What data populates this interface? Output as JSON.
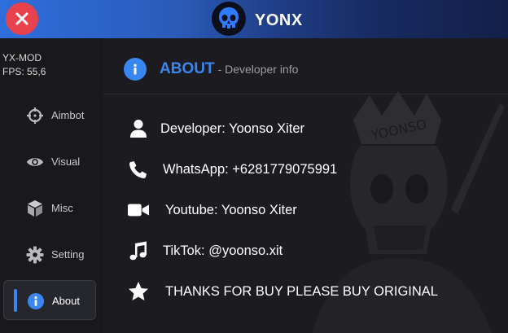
{
  "header": {
    "brand": "YONX"
  },
  "sidebar": {
    "app_name": "YX-MOD",
    "fps": "FPS: 55,6",
    "items": [
      {
        "label": "Aimbot",
        "icon": "crosshair-icon"
      },
      {
        "label": "Visual",
        "icon": "eye-icon"
      },
      {
        "label": "Misc",
        "icon": "cube-icon"
      },
      {
        "label": "Setting",
        "icon": "gear-icon"
      },
      {
        "label": "About",
        "icon": "info-icon",
        "active": true
      }
    ]
  },
  "main": {
    "section_title": "ABOUT",
    "section_subtitle": "- Developer info",
    "watermark_text": "YOONSO",
    "rows": [
      {
        "icon": "user-icon",
        "text": "Developer: Yoonso Xiter"
      },
      {
        "icon": "phone-icon",
        "text": "WhatsApp: +6281779075991"
      },
      {
        "icon": "video-icon",
        "text": "Youtube: Yoonso Xiter"
      },
      {
        "icon": "music-icon",
        "text": "TikTok: @yoonso.xit"
      },
      {
        "icon": "star-icon",
        "text": "THANKS FOR BUY PLEASE BUY ORIGINAL"
      }
    ]
  },
  "colors": {
    "accent": "#3a86f0",
    "close": "#e8434c",
    "sidebar_bg": "#19191c",
    "main_bg": "#1c1c20"
  }
}
